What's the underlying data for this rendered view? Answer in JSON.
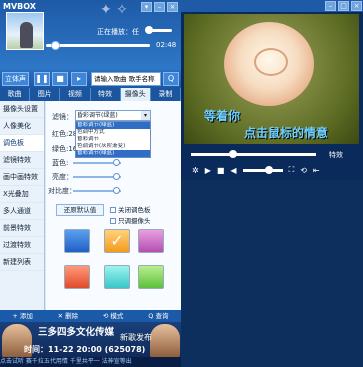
{
  "app": {
    "title": "MVBOX"
  },
  "player": {
    "status": "正在播放：任",
    "time": "02:48"
  },
  "controls": {
    "mode_label": "立体声",
    "search_placeholder": "请输入歌曲 歌手名称",
    "search_btn": "Q"
  },
  "tabs": [
    {
      "label": "歌曲"
    },
    {
      "label": "图片"
    },
    {
      "label": "视频"
    },
    {
      "label": "特效"
    },
    {
      "label": "摄像头"
    },
    {
      "label": "录制"
    }
  ],
  "sidebar": [
    {
      "label": "摄像头设置"
    },
    {
      "label": "人像美化"
    },
    {
      "label": "调色板"
    },
    {
      "label": "滤镜特效"
    },
    {
      "label": "画中画特效"
    },
    {
      "label": "X光叠加"
    },
    {
      "label": "多人通道"
    },
    {
      "label": "前景特效"
    },
    {
      "label": "过渡特效"
    },
    {
      "label": "新建列表"
    }
  ],
  "panel": {
    "filter_label": "滤镜：",
    "filter_value": "昏彩调节(绿蓝)",
    "filter_options": [
      "昏彩调节(绿蓝)",
      "色调中方式",
      "昏彩调节",
      "色调调节(灰阶渐变)",
      "昏彩调节(绿蓝)"
    ],
    "red_label": "红色:28",
    "green_label": "绿色:16",
    "blue_label": "蓝色:",
    "brightness_label": "亮度：",
    "contrast_label": "对比度：",
    "default_btn": "还原默认值",
    "check1": "关闭调色板",
    "check2": "只调摄像头",
    "swatch_check": "✓"
  },
  "bottombar": {
    "add": "+ 添加",
    "delete": "✕ 删除",
    "mode": "⟲ 模式",
    "search": "Q 查询"
  },
  "ad": {
    "title": "三多四多文化传媒",
    "new": "新歌发布",
    "time": "时间：11-22 20:00 (625078)",
    "marquee": "点击试听  赛千拉五代用情  千里共平一  法神宣等出"
  },
  "video": {
    "lyric1": "等着你",
    "lyric2_highlight": "点击",
    "lyric2_rest": "鼠标的情意",
    "effect_label": "特效"
  },
  "colors": {
    "accent": "#1e5aa6",
    "sidebar_bg": "#e9f1fb"
  }
}
